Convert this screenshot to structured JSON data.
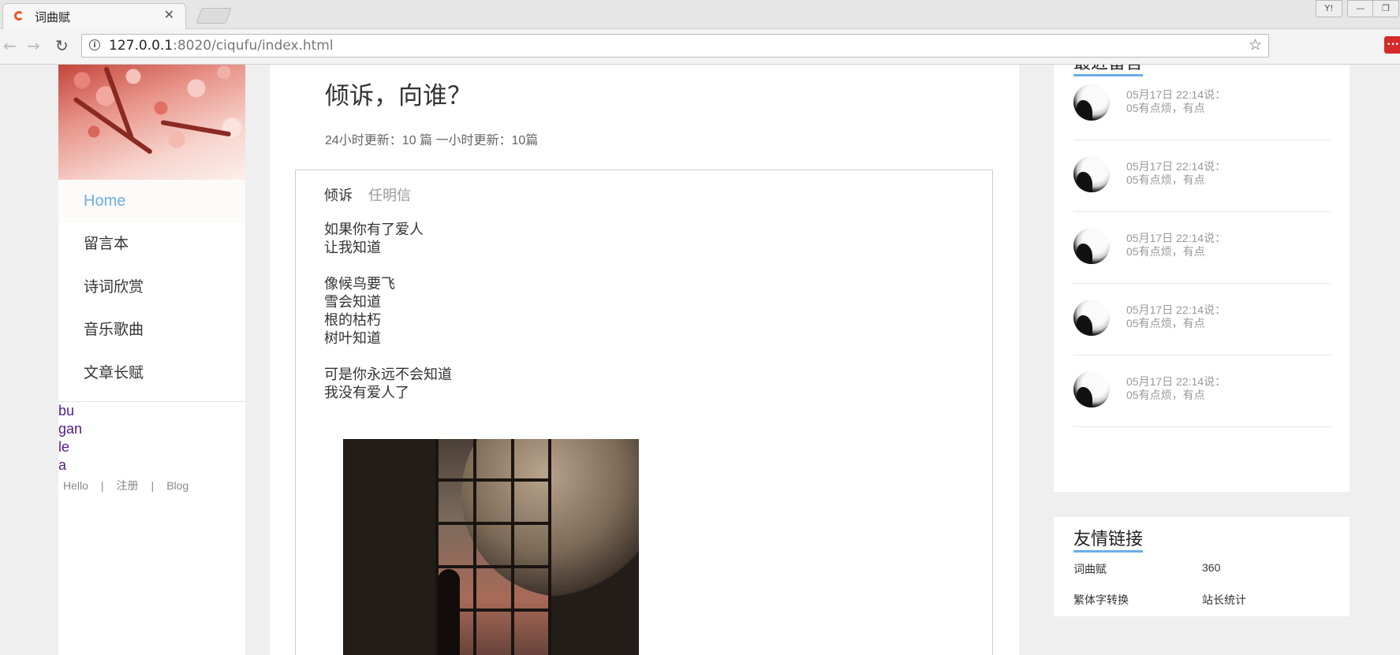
{
  "browser": {
    "tab_title": "词曲赋",
    "tab_close": "✕",
    "url_host": "127.0.0.1",
    "url_path": ":8020/ciqufu/index.html",
    "window_buttons": [
      "Y!",
      "—",
      "❐"
    ]
  },
  "sidebar": {
    "nav": [
      {
        "label": "Home",
        "active": true
      },
      {
        "label": "留言本"
      },
      {
        "label": "诗词欣赏"
      },
      {
        "label": "音乐歌曲"
      },
      {
        "label": "文章长赋"
      }
    ],
    "bug_lines": [
      "bu",
      "gan",
      "le",
      "a"
    ],
    "footer_links": [
      "Hello",
      "注册",
      "Blog"
    ],
    "footer_sep": "|"
  },
  "main": {
    "title": "倾诉，向谁？",
    "stats": "24小时更新：10 篇 一小时更新：10篇",
    "poem": {
      "title": "倾诉",
      "author": "任明信",
      "stanzas": [
        [
          "如果你有了爱人",
          "让我知道"
        ],
        [
          "像候鸟要飞",
          "雪会知道",
          "根的枯朽",
          "树叶知道"
        ],
        [
          "可是你永远不会知道",
          "我没有爱人了"
        ]
      ]
    }
  },
  "comments": {
    "title": "最近留言",
    "items": [
      {
        "meta": "05月17日 22:14说：",
        "text": "05有点烦，有点"
      },
      {
        "meta": "05月17日 22:14说：",
        "text": "05有点烦，有点"
      },
      {
        "meta": "05月17日 22:14说：",
        "text": "05有点烦，有点"
      },
      {
        "meta": "05月17日 22:14说：",
        "text": "05有点烦，有点"
      },
      {
        "meta": "05月17日 22:14说：",
        "text": "05有点烦，有点"
      }
    ]
  },
  "friend_links": {
    "title": "友情链接",
    "items": [
      "词曲赋",
      "360",
      "繁体字转换",
      "站长统计"
    ]
  }
}
